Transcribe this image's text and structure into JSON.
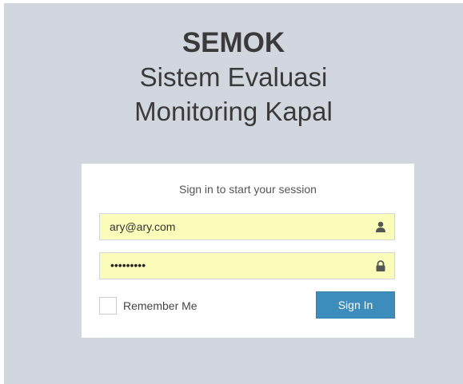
{
  "logo": {
    "brand": "SEMOK",
    "line1": "Sistem Evaluasi",
    "line2": "Monitoring Kapal"
  },
  "login": {
    "message": "Sign in to start your session",
    "email": {
      "value": "ary@ary.com",
      "icon": "user-icon"
    },
    "password": {
      "masked_value": "•••••••••",
      "icon": "lock-icon"
    },
    "remember_label": "Remember Me",
    "remember_checked": false,
    "signin_label": "Sign In"
  },
  "colors": {
    "background": "#d2d6de",
    "input_autofill": "#fbfcba",
    "primary": "#3c8dbc"
  }
}
